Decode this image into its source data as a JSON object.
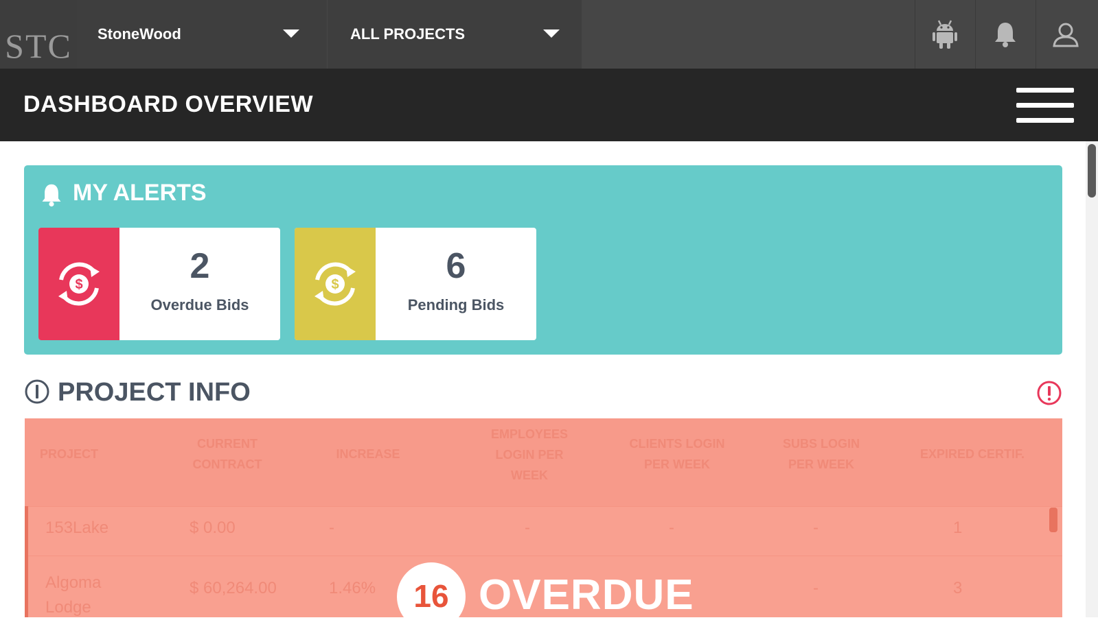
{
  "brand": {
    "logo_text": "STC"
  },
  "topbar": {
    "company_select": "StoneWood",
    "project_select": "ALL PROJECTS",
    "icons": [
      "android-icon",
      "bell-icon",
      "user-icon"
    ]
  },
  "header": {
    "title": "DASHBOARD OVERVIEW"
  },
  "alerts": {
    "title": "MY ALERTS",
    "cards": [
      {
        "count": "2",
        "label": "Overdue Bids",
        "color": "#e8375a"
      },
      {
        "count": "6",
        "label": "Pending Bids",
        "color": "#d9c84a"
      }
    ]
  },
  "project_info": {
    "title": "PROJECT INFO",
    "columns": [
      "PROJECT",
      "CURRENT CONTRACT",
      "INCREASE",
      "EMPLOYEES LOGIN PER WEEK",
      "CLIENTS LOGIN PER WEEK",
      "SUBS LOGIN PER WEEK",
      "EXPIRED CERTIF."
    ],
    "rows": [
      [
        "153Lake",
        "$ 0.00",
        "-",
        "-",
        "-",
        "-",
        "1"
      ],
      [
        "Algoma Lodge",
        "$ 60,264.00",
        "1.46%",
        "",
        "",
        "-",
        "3"
      ]
    ],
    "overdue": {
      "count": "16",
      "label": "OVERDUE"
    }
  },
  "colors": {
    "topbar": "#464646",
    "titlebar": "#262626",
    "alerts_bg": "#66cbc9",
    "overdue_overlay": "#f9a090"
  }
}
